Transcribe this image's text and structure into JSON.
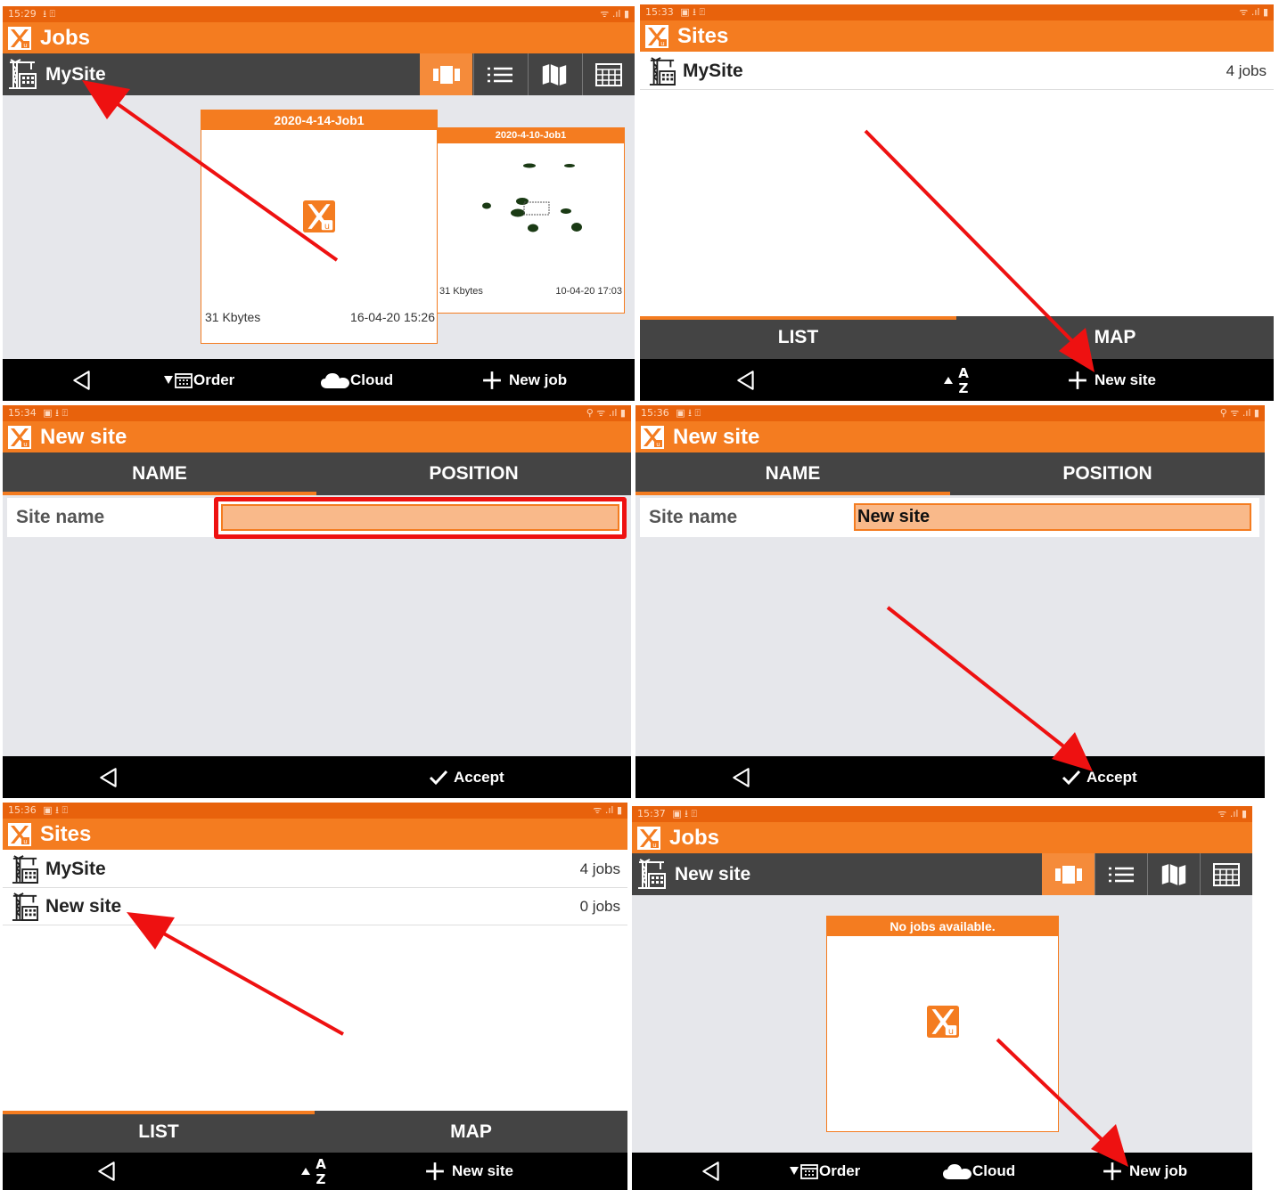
{
  "panel1": {
    "status_time": "15:29",
    "status_icons": "⭳ ⍐",
    "sys_icons": "ᯤ .ıl ▮",
    "app_title": "Jobs",
    "site_name": "MySite",
    "jobs": [
      {
        "title": "2020-4-14-Job1",
        "size": "31 Kbytes",
        "date": "16-04-20 15:26"
      },
      {
        "title": "2020-4-10-Job1",
        "size": "31 Kbytes",
        "date": "10-04-20 17:03"
      }
    ],
    "bottom": {
      "order": "Order",
      "cloud": "Cloud",
      "new_job": "New job"
    }
  },
  "panel2": {
    "status_time": "15:33",
    "status_icons": "▣ ⭳ ⍐",
    "sys_icons": "ᯤ .ıl ▮",
    "app_title": "Sites",
    "site": {
      "name": "MySite",
      "count": "4 jobs"
    },
    "tabs": {
      "list": "LIST",
      "map": "MAP"
    },
    "bottom": {
      "sort_a": "A",
      "sort_z": "Z",
      "new_site": "New site"
    }
  },
  "panel3": {
    "status_time": "15:34",
    "status_icons": "▣ ⭳ ⍐",
    "sys_icons": "⚲ ᯤ .ıl ▮",
    "app_title": "New site",
    "tabs": {
      "name": "NAME",
      "position": "POSITION"
    },
    "field_label": "Site name",
    "field_value": "",
    "bottom": {
      "accept": "Accept"
    }
  },
  "panel4": {
    "status_time": "15:36",
    "status_icons": "▣ ⭳ ⍐",
    "sys_icons": "⚲ ᯤ .ıl ▮",
    "app_title": "New site",
    "tabs": {
      "name": "NAME",
      "position": "POSITION"
    },
    "field_label": "Site name",
    "field_value": "New site",
    "bottom": {
      "accept": "Accept"
    }
  },
  "panel5": {
    "status_time": "15:36",
    "status_icons": "▣ ⭳ ⍐",
    "sys_icons": "ᯤ .ıl ▮",
    "app_title": "Sites",
    "sites": [
      {
        "name": "MySite",
        "count": "4 jobs"
      },
      {
        "name": "New site",
        "count": "0 jobs"
      }
    ],
    "tabs": {
      "list": "LIST",
      "map": "MAP"
    },
    "bottom": {
      "sort_a": "A",
      "sort_z": "Z",
      "new_site": "New site"
    }
  },
  "panel6": {
    "status_time": "15:37",
    "status_icons": "▣ ⭳ ⍐",
    "sys_icons": "ᯤ .ıl ▮",
    "app_title": "Jobs",
    "site_name": "New site",
    "empty_card_title": "No jobs available.",
    "bottom": {
      "order": "Order",
      "cloud": "Cloud",
      "new_job": "New job"
    }
  },
  "colors": {
    "accent": "#f47c20",
    "status": "#e8620c",
    "dark": "#444444",
    "arrow": "#ee1111"
  }
}
